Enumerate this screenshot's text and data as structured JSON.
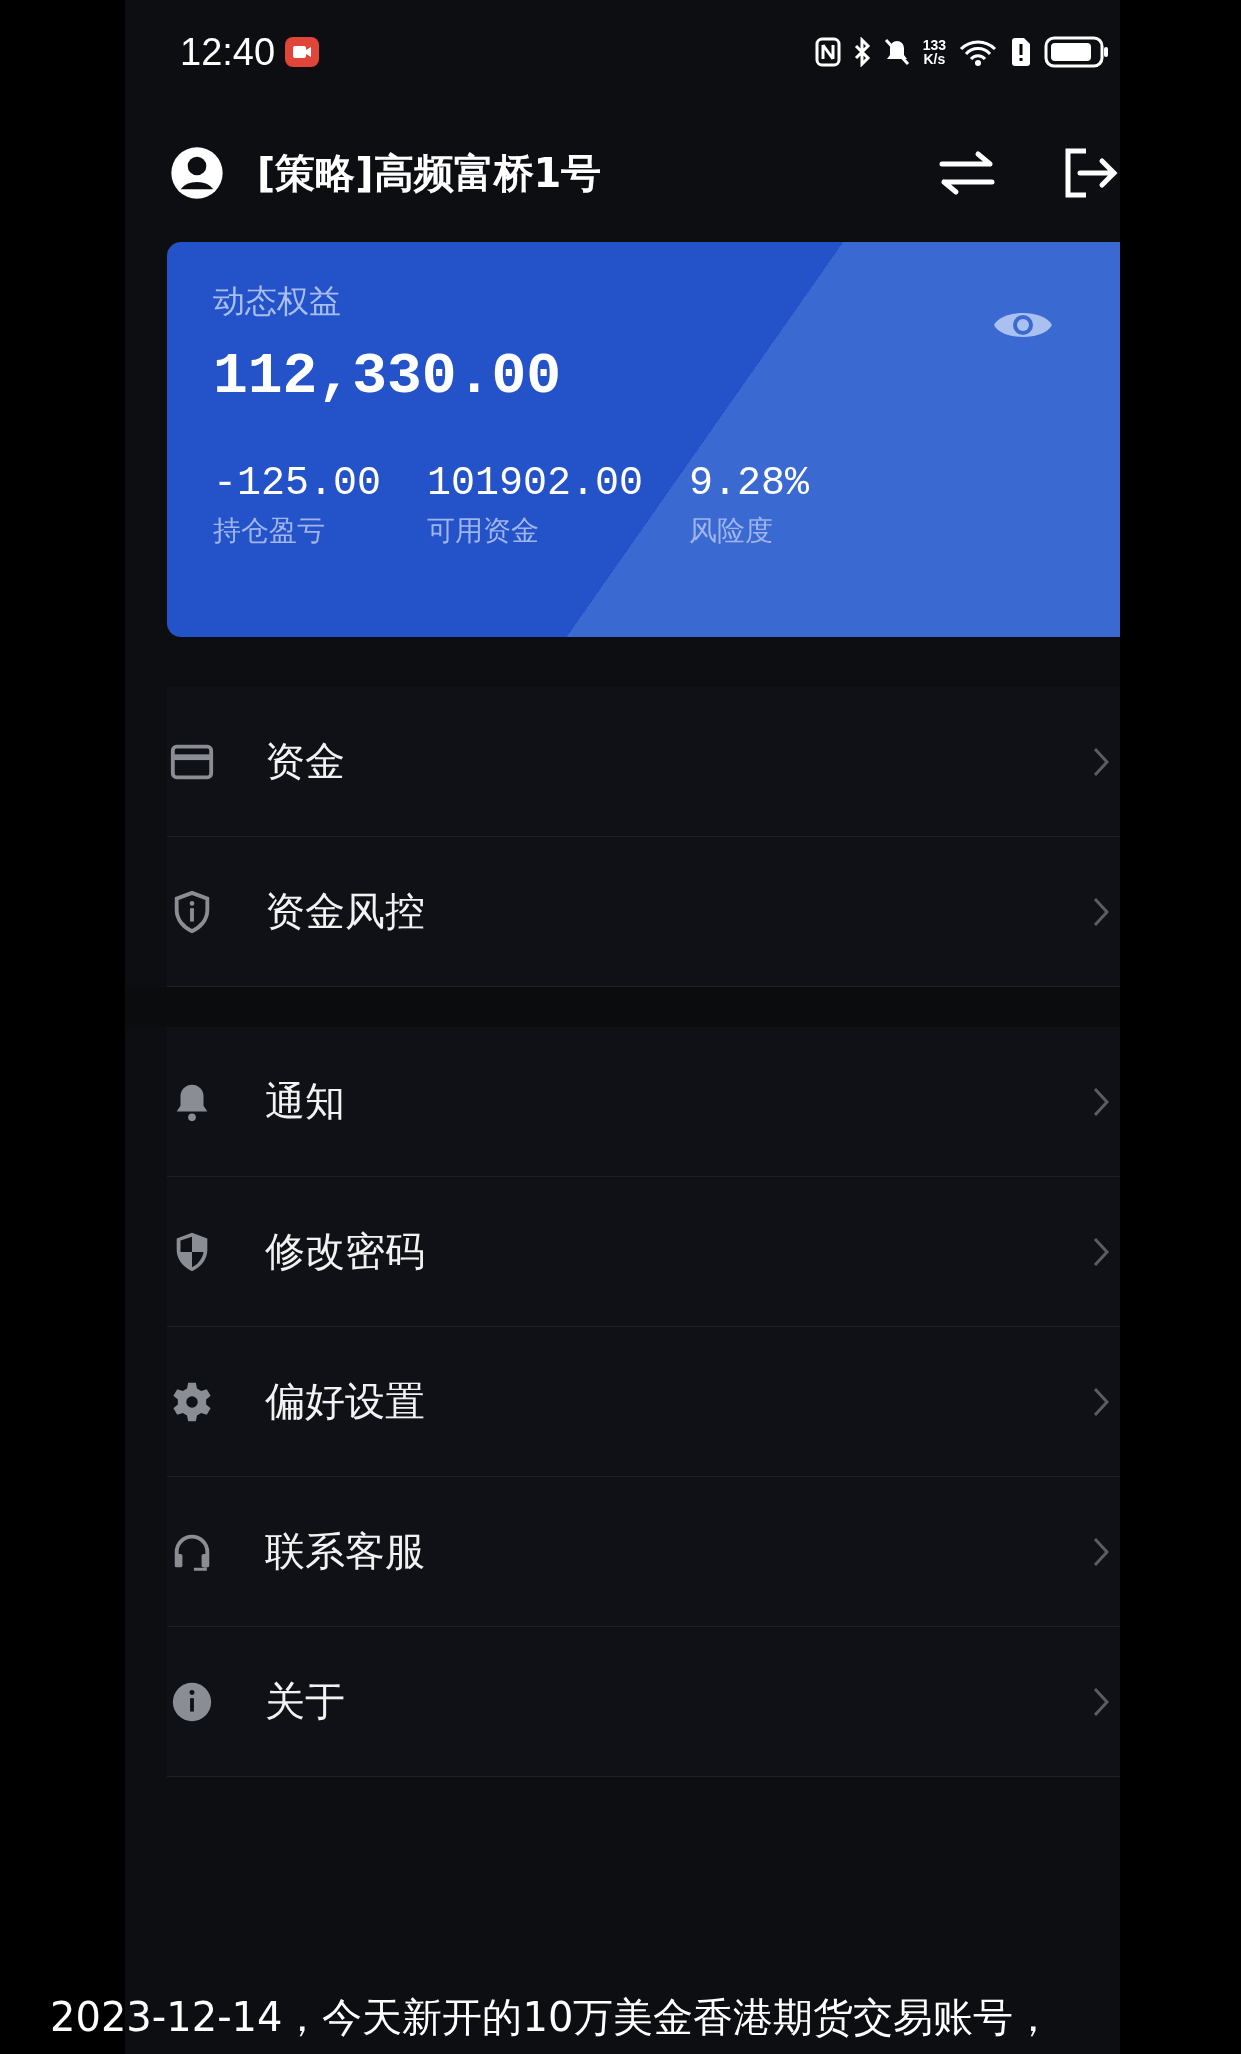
{
  "status_bar": {
    "time": "12:40",
    "net_speed": "133",
    "net_unit": "K/s"
  },
  "header": {
    "account": "[策略]高频富桥1号"
  },
  "equity_card": {
    "label": "动态权益",
    "value": "112,330.00",
    "stats": [
      {
        "value": "-125.00",
        "label": "持仓盈亏"
      },
      {
        "value": "101902.00",
        "label": "可用资金"
      },
      {
        "value": "9.28%",
        "label": "风险度"
      }
    ]
  },
  "menu_groups": [
    {
      "items": [
        {
          "kind": "card",
          "label": "资金"
        },
        {
          "kind": "shieldinfo",
          "label": "资金风控"
        }
      ]
    },
    {
      "items": [
        {
          "kind": "bell",
          "label": "通知"
        },
        {
          "kind": "shield",
          "label": "修改密码"
        },
        {
          "kind": "gear",
          "label": "偏好设置"
        },
        {
          "kind": "headset",
          "label": "联系客服"
        },
        {
          "kind": "info",
          "label": "关于"
        }
      ]
    }
  ],
  "caption": "2023-12-14，今天新开的10万美金香港期货交易账号，"
}
